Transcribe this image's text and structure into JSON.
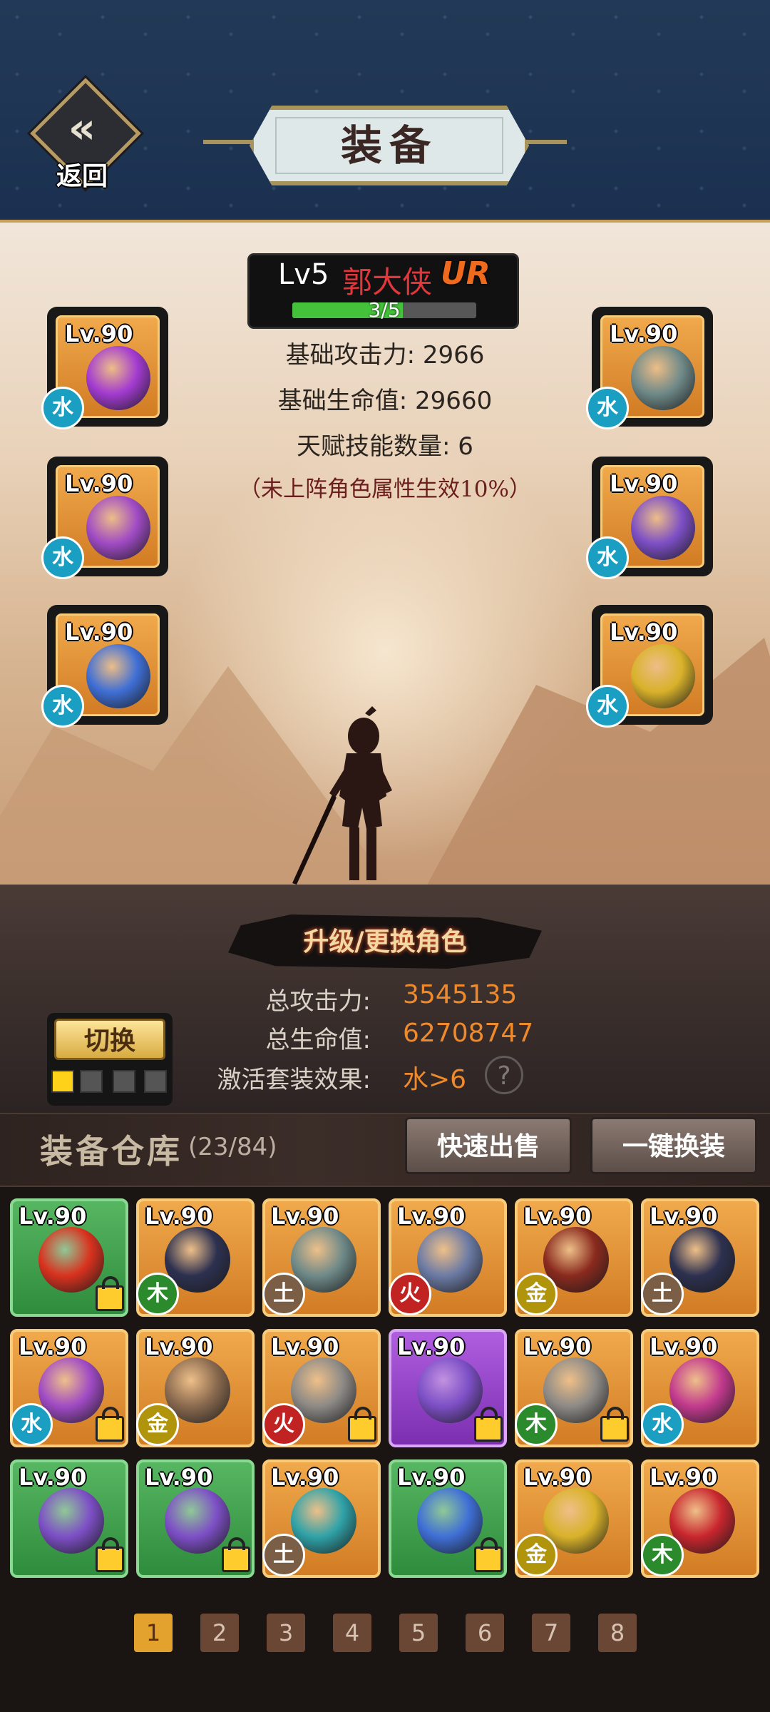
{
  "header": {
    "back_label": "返回",
    "title": "装备"
  },
  "hero": {
    "level": "Lv5",
    "name": "郭大侠",
    "rank": "UR",
    "xp_text": "3/5",
    "xp_fraction": 0.6,
    "base_attack": "基础攻击力: 2966",
    "base_hp": "基础生命值: 29660",
    "talent_count": "天赋技能数量: 6",
    "note": "（未上阵角色属性生效10%）"
  },
  "equipped": [
    {
      "lv": "Lv.90",
      "element": "水",
      "icon": "dragon-sword-icon",
      "color": "#a33bd1"
    },
    {
      "lv": "Lv.90",
      "element": "水",
      "icon": "chest-armor-icon",
      "color": "#6f8a89"
    },
    {
      "lv": "Lv.90",
      "element": "水",
      "icon": "helmet-icon",
      "color": "#a04bc5"
    },
    {
      "lv": "Lv.90",
      "element": "水",
      "icon": "boots-icon",
      "color": "#7d4fc6"
    },
    {
      "lv": "Lv.90",
      "element": "水",
      "icon": "dragon-necklace-icon",
      "color": "#3f6fd6"
    },
    {
      "lv": "Lv.90",
      "element": "水",
      "icon": "gold-ring-icon",
      "color": "#d9b22a"
    }
  ],
  "upgrade_label": "升级/更换角色",
  "totals": {
    "attack_label": "总攻击力:",
    "attack_value": "3545135",
    "hp_label": "总生命值:",
    "hp_value": "62708747",
    "set_label": "激活套装效果:",
    "set_value": "水>6",
    "help": "?"
  },
  "switch_label": "切换",
  "warehouse": {
    "title": "装备仓库",
    "count": "(23/84)",
    "quick_sell": "快速出售",
    "one_click": "一键换装"
  },
  "inventory": [
    {
      "lv": "Lv.90",
      "bg": "green",
      "element": "",
      "locked": true,
      "icon": "fire-sword-icon",
      "color": "#d9321e"
    },
    {
      "lv": "Lv.90",
      "bg": "orange",
      "element": "木",
      "locked": false,
      "icon": "hooded-cloak-icon",
      "color": "#2d3150"
    },
    {
      "lv": "Lv.90",
      "bg": "orange",
      "element": "土",
      "locked": false,
      "icon": "chest-armor-icon",
      "color": "#6f8a89"
    },
    {
      "lv": "Lv.90",
      "bg": "orange",
      "element": "火",
      "locked": false,
      "icon": "plate-armor-icon",
      "color": "#6c7ba5"
    },
    {
      "lv": "Lv.90",
      "bg": "orange",
      "element": "金",
      "locked": false,
      "icon": "red-armor-icon",
      "color": "#8a2a1e"
    },
    {
      "lv": "Lv.90",
      "bg": "orange",
      "element": "土",
      "locked": false,
      "icon": "hooded-cloak-icon",
      "color": "#2d3150"
    },
    {
      "lv": "Lv.90",
      "bg": "orange",
      "element": "水",
      "locked": true,
      "icon": "helmet-icon",
      "color": "#a04bc5"
    },
    {
      "lv": "Lv.90",
      "bg": "orange",
      "element": "金",
      "locked": false,
      "icon": "bronze-helmet-icon",
      "color": "#8a6a4f"
    },
    {
      "lv": "Lv.90",
      "bg": "orange",
      "element": "火",
      "locked": true,
      "icon": "steel-boots-icon",
      "color": "#8d8a86"
    },
    {
      "lv": "Lv.90",
      "bg": "purple",
      "element": "",
      "locked": true,
      "icon": "boots-icon",
      "color": "#7d4fc6"
    },
    {
      "lv": "Lv.90",
      "bg": "orange",
      "element": "木",
      "locked": true,
      "icon": "steel-boots-icon",
      "color": "#8d8a86"
    },
    {
      "lv": "Lv.90",
      "bg": "orange",
      "element": "水",
      "locked": false,
      "icon": "pink-boots-icon",
      "color": "#c23a8e"
    },
    {
      "lv": "Lv.90",
      "bg": "green",
      "element": "",
      "locked": true,
      "icon": "boots-icon",
      "color": "#7d4fc6"
    },
    {
      "lv": "Lv.90",
      "bg": "green",
      "element": "",
      "locked": true,
      "icon": "boots-icon",
      "color": "#7d4fc6"
    },
    {
      "lv": "Lv.90",
      "bg": "orange",
      "element": "土",
      "locked": false,
      "icon": "jade-necklace-icon",
      "color": "#2fa2a8"
    },
    {
      "lv": "Lv.90",
      "bg": "green",
      "element": "",
      "locked": true,
      "icon": "dragon-necklace-icon",
      "color": "#3f6fd6"
    },
    {
      "lv": "Lv.90",
      "bg": "orange",
      "element": "金",
      "locked": false,
      "icon": "gold-ring-icon",
      "color": "#d9b22a"
    },
    {
      "lv": "Lv.90",
      "bg": "orange",
      "element": "木",
      "locked": false,
      "icon": "ruby-ring-icon",
      "color": "#c8262e"
    }
  ],
  "pages": [
    "1",
    "2",
    "3",
    "4",
    "5",
    "6",
    "7",
    "8"
  ],
  "active_page": "1"
}
